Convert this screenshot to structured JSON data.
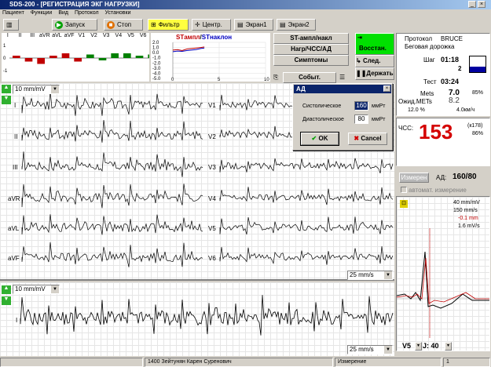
{
  "window": {
    "title": "SDS-200 - [РЕГИСТРАЦИЯ ЭКГ НАГРУЗКИ]"
  },
  "menu": [
    "Пациент",
    "Функции",
    "Вид",
    "Протокол",
    "Установки"
  ],
  "toolbar": {
    "start": "Запуск",
    "stop": "Стоп",
    "filter": "Фильтр",
    "center": "Центр.",
    "screen1": "Экран1",
    "screen2": "Экран2"
  },
  "leads_header": [
    "I",
    "II",
    "III",
    "aVR",
    "aVL",
    "aVF",
    "V1",
    "V2",
    "V3",
    "V4",
    "V5",
    "V6"
  ],
  "st_chart": {
    "title_a": "STампл",
    "sep": "/",
    "title_b": "STнаклон",
    "yticks": [
      "2.0",
      "1.0",
      "0.0",
      "-1.0",
      "-2.0",
      "-3.0",
      "-4.0",
      "-5.0"
    ],
    "xticks": [
      "0",
      "5",
      "10"
    ]
  },
  "side_buttons": {
    "st": "ST-ампл/накл",
    "load": "Нагр/ЧСС/АД",
    "symptoms": "Симптомы",
    "event": "Событ."
  },
  "control_buttons": {
    "restore": "Восстан.",
    "next": "След.",
    "hold": "Держать"
  },
  "dialog": {
    "title": "АД",
    "systolic_label": "Систолическое",
    "systolic_value": "160",
    "systolic_unit": "ммРт",
    "diastolic_label": "Диастолическое",
    "diastolic_value": "80",
    "diastolic_unit": "ммРт",
    "ok": "OK",
    "cancel": "Cancel"
  },
  "ecg": {
    "gain_top": "10 mm/mV",
    "gain_bottom": "10 mm/mV",
    "speed_top": "25 mm/s",
    "speed_bottom": "25 mm/s",
    "left_leads": [
      "I",
      "II",
      "III",
      "aVR",
      "aVL",
      "aVF"
    ],
    "right_leads": [
      "V1",
      "V2",
      "V3",
      "V4",
      "V5",
      "V6"
    ],
    "rhythm_lead": "I"
  },
  "protocol": {
    "label": "Протокол",
    "name": "BRUCE",
    "type": "Беговая дорожка",
    "step_label": "Шаг",
    "step_time": "01:18",
    "step_num": "2",
    "test_label": "Тест",
    "test_time": "03:24",
    "mets_label": "Mets",
    "mets_value": "7.0",
    "mets_pct": "85%",
    "exp_mets_label": "Ожид.METs",
    "exp_mets_value": "8.2",
    "grade": "12.0 %",
    "speed": "4.0км/ч"
  },
  "hr": {
    "label": "ЧСС:",
    "value": "153",
    "target": "(к178)",
    "pct": "86%"
  },
  "bp": {
    "measure_btn": "Измерен",
    "label": "АД:",
    "value": "160/80",
    "auto_label": "автомат. измерение"
  },
  "complex": {
    "gain": "40 mm/mV",
    "speed": "150 mm/s",
    "st": "-0.1 mm",
    "slope": "1.6 mV/s",
    "lead": "V5",
    "j_label": "J: 40"
  },
  "status": {
    "patient": "1400  Зейтунян Карен Суренович",
    "mode": "Измерение",
    "page": "1"
  },
  "bars": [
    {
      "lead": "I",
      "value": 0.2
    },
    {
      "lead": "II",
      "value": -0.3
    },
    {
      "lead": "III",
      "value": -0.5
    },
    {
      "lead": "aVR",
      "value": 0.2
    },
    {
      "lead": "aVL",
      "value": 0.4
    },
    {
      "lead": "aVF",
      "value": -0.3
    },
    {
      "lead": "V1",
      "value": 0.3
    },
    {
      "lead": "V2",
      "value": -0.2
    },
    {
      "lead": "V3",
      "value": 0.4
    },
    {
      "lead": "V4",
      "value": 0.4
    },
    {
      "lead": "V5",
      "value": 0.2
    },
    {
      "lead": "V6",
      "value": 0.3
    }
  ],
  "colors": {
    "accent_green": "#00e000",
    "hr_red": "#d40000",
    "title_blue": "#0a246a"
  }
}
